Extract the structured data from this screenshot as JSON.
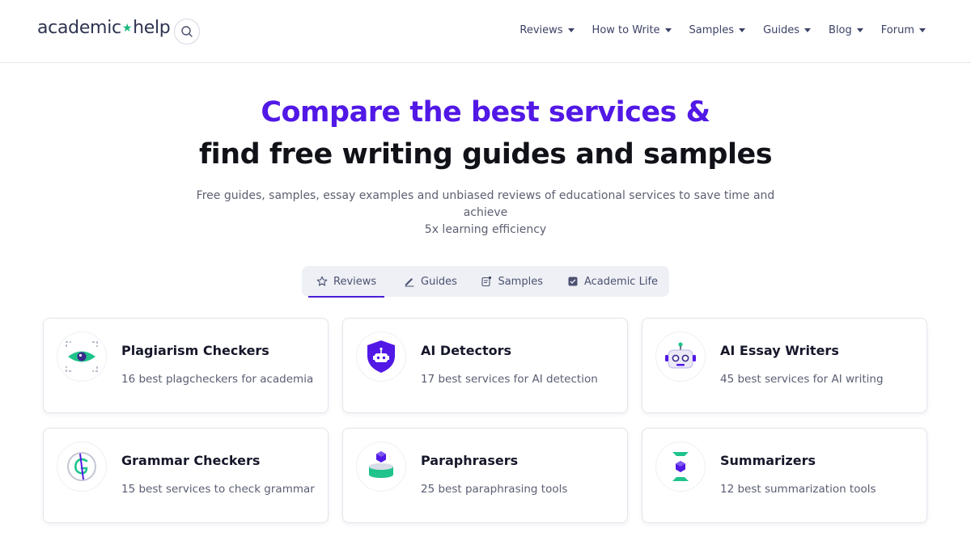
{
  "header": {
    "logo_left": "academic",
    "logo_star": "★",
    "logo_right": "help",
    "nav": [
      {
        "label": "Reviews"
      },
      {
        "label": "How to Write"
      },
      {
        "label": "Samples"
      },
      {
        "label": "Guides"
      },
      {
        "label": "Blog"
      },
      {
        "label": "Forum"
      }
    ]
  },
  "hero": {
    "title_line1": "Compare the best services &",
    "title_line2": "find free writing guides and samples",
    "subtitle_line1": "Free guides, samples, essay examples and unbiased reviews of educational services to save time and achieve",
    "subtitle_line2": "5x learning efficiency"
  },
  "tabs": [
    {
      "label": "Reviews",
      "icon": "star-icon",
      "active": true
    },
    {
      "label": "Guides",
      "icon": "pencil-icon",
      "active": false
    },
    {
      "label": "Samples",
      "icon": "document-icon",
      "active": false
    },
    {
      "label": "Academic Life",
      "icon": "checkbox-icon",
      "active": false
    }
  ],
  "cards": [
    {
      "title": "Plagiarism Checkers",
      "desc": "16 best plagcheckers for academia",
      "icon": "eye-scan-icon"
    },
    {
      "title": "AI Detectors",
      "desc": "17 best services for AI detection",
      "icon": "robot-shield-icon"
    },
    {
      "title": "AI Essay Writers",
      "desc": "45 best services for AI writing",
      "icon": "robot-icon"
    },
    {
      "title": "Grammar Checkers",
      "desc": "15 best services to check grammar",
      "icon": "grammar-g-icon"
    },
    {
      "title": "Paraphrasers",
      "desc": "25 best paraphrasing tools",
      "icon": "cube-stack-icon"
    },
    {
      "title": "Summarizers",
      "desc": "12 best summarization tools",
      "icon": "hourglass-cube-icon"
    }
  ],
  "colors": {
    "accent": "#5118e6",
    "green": "#1fc38b",
    "text_dark": "#111218",
    "nav_text": "#3c4266"
  }
}
